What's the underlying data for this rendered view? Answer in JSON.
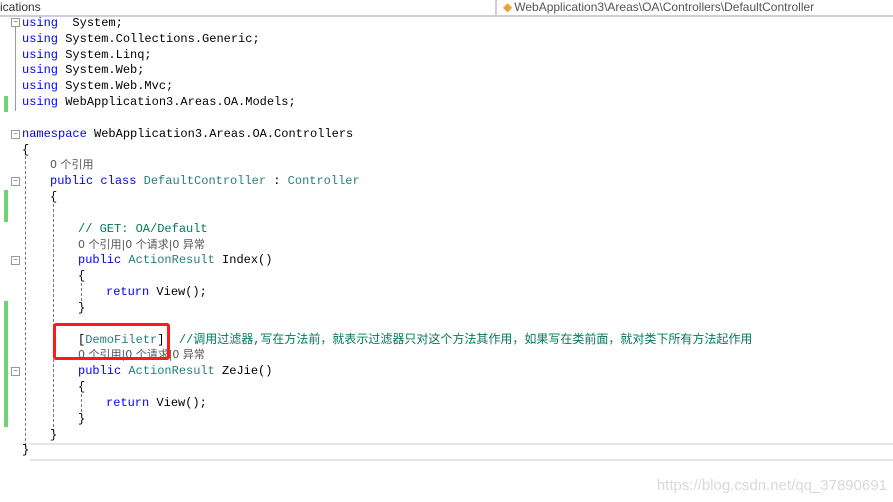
{
  "tabs": {
    "left_label": "ications",
    "right_label": "WebApplication3\\Areas\\OA\\Controllers\\DefaultController",
    "right_icon": "csharp-file-icon"
  },
  "colors": {
    "keyword": "#0000ff",
    "type": "#267f7f",
    "comment": "#007a5a",
    "highlight_box": "#ff1a1a",
    "change_bar": "#6fd36f"
  },
  "code": [
    {
      "i": 0,
      "t": [
        [
          "kw",
          "using"
        ],
        [
          "",
          "  System;"
        ]
      ]
    },
    {
      "i": 0,
      "t": [
        [
          "kw",
          "using"
        ],
        [
          "",
          " System.Collections.Generic;"
        ]
      ]
    },
    {
      "i": 0,
      "t": [
        [
          "kw",
          "using"
        ],
        [
          "",
          " System.Linq;"
        ]
      ]
    },
    {
      "i": 0,
      "t": [
        [
          "kw",
          "using"
        ],
        [
          "",
          " System.Web;"
        ]
      ]
    },
    {
      "i": 0,
      "t": [
        [
          "kw",
          "using"
        ],
        [
          "",
          " System.Web.Mvc;"
        ]
      ]
    },
    {
      "i": 0,
      "t": [
        [
          "kw",
          "using"
        ],
        [
          "",
          " WebApplication3.Areas.OA.Models;"
        ]
      ]
    },
    {
      "i": 0,
      "t": []
    },
    {
      "i": 0,
      "t": [
        [
          "kw",
          "namespace"
        ],
        [
          "",
          " WebApplication3.Areas.OA.Controllers"
        ]
      ]
    },
    {
      "i": 0,
      "t": [
        [
          "",
          "{"
        ]
      ]
    },
    {
      "i": 4,
      "t": [
        [
          "cl",
          "0 个引用"
        ]
      ]
    },
    {
      "i": 4,
      "t": [
        [
          "kw",
          "public"
        ],
        [
          "",
          " "
        ],
        [
          "kw",
          "class"
        ],
        [
          "",
          " "
        ],
        [
          "ty",
          "DefaultController"
        ],
        [
          "",
          " : "
        ],
        [
          "ty",
          "Controller"
        ]
      ]
    },
    {
      "i": 4,
      "t": [
        [
          "",
          "{"
        ]
      ]
    },
    {
      "i": 0,
      "t": []
    },
    {
      "i": 8,
      "t": [
        [
          "cm",
          "// GET: OA/Default"
        ]
      ]
    },
    {
      "i": 8,
      "t": [
        [
          "cl",
          "0 个引用|0 个请求|0 异常"
        ]
      ]
    },
    {
      "i": 8,
      "t": [
        [
          "kw",
          "public"
        ],
        [
          "",
          " "
        ],
        [
          "ty",
          "ActionResult"
        ],
        [
          "",
          " Index()"
        ]
      ]
    },
    {
      "i": 8,
      "t": [
        [
          "",
          "{"
        ]
      ]
    },
    {
      "i": 12,
      "t": [
        [
          "kw",
          "return"
        ],
        [
          "",
          " View();"
        ]
      ]
    },
    {
      "i": 8,
      "t": [
        [
          "",
          "}"
        ]
      ]
    },
    {
      "i": 0,
      "t": []
    },
    {
      "i": 8,
      "t": [
        [
          "",
          "["
        ],
        [
          "at",
          "DemoFiletr"
        ],
        [
          "",
          "]  "
        ],
        [
          "cm",
          "//调用过滤器,写在方法前，就表示过滤器只对这个方法其作用，如果写在类前面，就对类下所有方法起作用"
        ]
      ]
    },
    {
      "i": 8,
      "t": [
        [
          "cl",
          "0 个引用|0 个请求|0 异常"
        ]
      ]
    },
    {
      "i": 8,
      "t": [
        [
          "kw",
          "public"
        ],
        [
          "",
          " "
        ],
        [
          "ty",
          "ActionResult"
        ],
        [
          "",
          " ZeJie()"
        ]
      ]
    },
    {
      "i": 8,
      "t": [
        [
          "",
          "{"
        ]
      ]
    },
    {
      "i": 12,
      "t": [
        [
          "kw",
          "return"
        ],
        [
          "",
          " View();"
        ]
      ]
    },
    {
      "i": 8,
      "t": [
        [
          "",
          "}"
        ]
      ]
    },
    {
      "i": 4,
      "t": [
        [
          "",
          "}"
        ]
      ]
    },
    {
      "i": 0,
      "t": [
        [
          "",
          "}"
        ]
      ]
    }
  ],
  "watermark": "https://blog.csdn.net/qq_37890691"
}
